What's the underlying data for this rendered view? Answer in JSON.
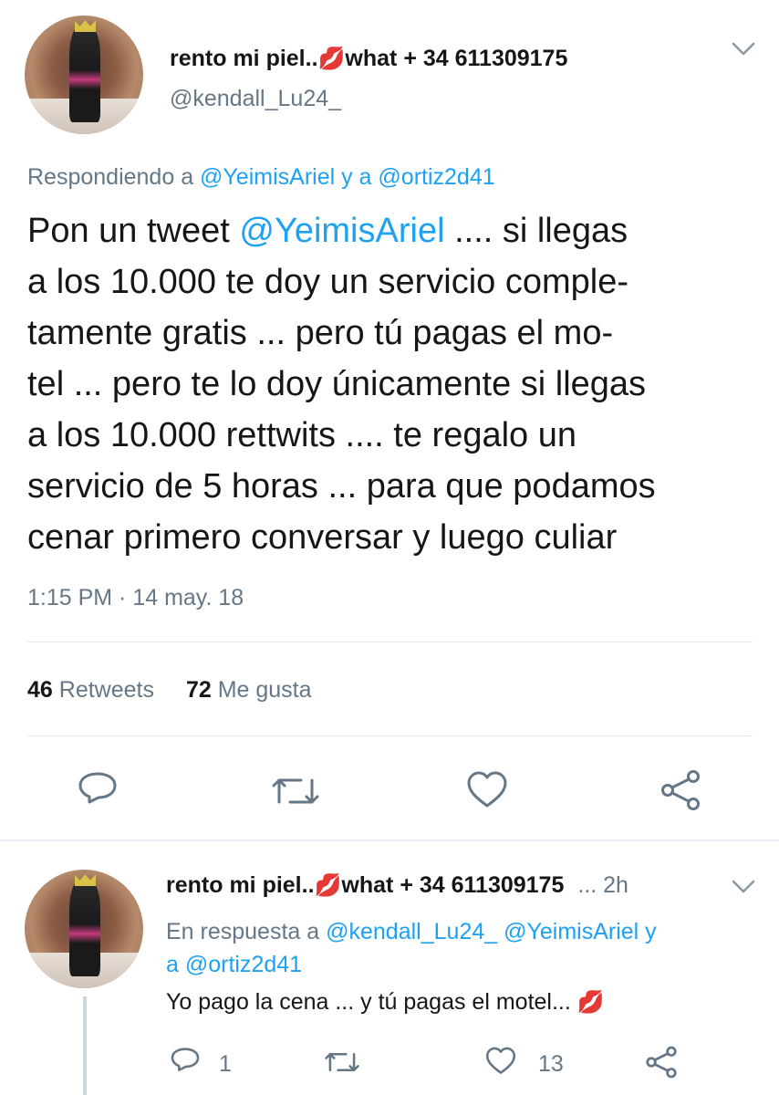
{
  "tweet": {
    "display_name": "rento mi piel..",
    "name_emoji": "💋",
    "name_suffix": "what + 34 611309175",
    "handle": "@kendall_Lu24_",
    "reply_prefix": "Respondiendo a ",
    "reply_user1": "@YeimisAriel",
    "reply_and": " y a ",
    "reply_user2": "@ortiz2d41",
    "lines": {
      "l1_a": "Pon un tweet ",
      "l1_mention": "@YeimisAriel",
      "l1_b": " .... si llegas",
      "l2": "a los 10.000 te doy un servicio comple-",
      "l3": "tamente gratis ... pero tú pagas el mo-",
      "l4": "tel ... pero te lo doy únicamente si llegas",
      "l5": "a los 10.000 rettwits .... te regalo un",
      "l6": "servicio de 5 horas ... para que podamos",
      "l7": "cenar primero conversar y luego culiar"
    },
    "timestamp": "1:15 PM · 14 may. 18",
    "retweets_count": "46",
    "retweets_label": "Retweets",
    "likes_count": "72",
    "likes_label": "Me gusta"
  },
  "reply": {
    "display_name": "rento mi piel..",
    "name_emoji": "💋",
    "name_suffix": "what + 34 611309175",
    "truncation": "...",
    "time": "2h",
    "response_prefix": "En respuesta a ",
    "response_user1": "@kendall_Lu24_",
    "response_user2": "@YeimisAriel",
    "response_y": " y",
    "response_a": "a ",
    "response_user3": "@ortiz2d41",
    "text": "Yo pago la cena ... y tú pagas el motel... ",
    "text_emoji": "💋",
    "reply_count": "1",
    "like_count": "13"
  },
  "colors": {
    "link": "#1da1f2",
    "muted": "#657786",
    "text": "#14171a",
    "divider": "#e1e8ed"
  },
  "icons": [
    "chevron-down-icon",
    "reply-icon",
    "retweet-icon",
    "like-icon",
    "share-icon"
  ]
}
